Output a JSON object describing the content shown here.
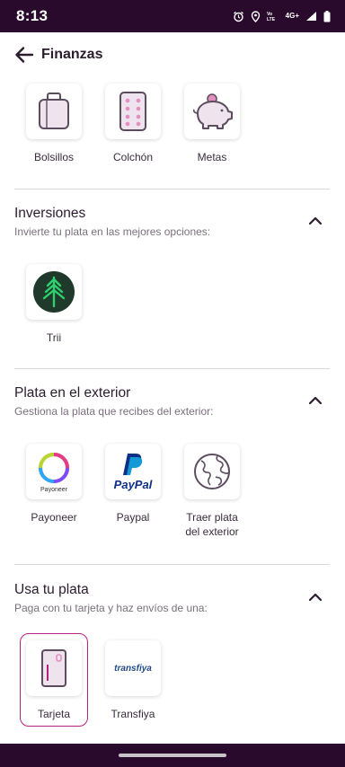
{
  "status_bar": {
    "time": "8:13",
    "network_label": "4G+",
    "icons": [
      "alarm-icon",
      "location-icon",
      "volte-icon",
      "signal-icon",
      "battery-icon"
    ]
  },
  "header": {
    "title": "Finanzas",
    "back_icon": "arrow-left-icon"
  },
  "top_tiles": [
    {
      "label": "Bolsillos",
      "icon": "wallet-icon"
    },
    {
      "label": "Colchón",
      "icon": "mattress-icon"
    },
    {
      "label": "Metas",
      "icon": "piggy-bank-icon"
    }
  ],
  "sections": [
    {
      "title": "Inversiones",
      "subtitle": "Invierte tu plata en las mejores opciones:",
      "expanded": true,
      "tiles": [
        {
          "label": "Trii",
          "icon": "trii-logo"
        }
      ]
    },
    {
      "title": "Plata en el exterior",
      "subtitle": "Gestiona la plata que recibes del exterior:",
      "expanded": true,
      "tiles": [
        {
          "label": "Payoneer",
          "icon": "payoneer-logo",
          "logo_text": "Payoneer"
        },
        {
          "label": "Paypal",
          "icon": "paypal-logo",
          "logo_text": "PayPal"
        },
        {
          "label": "Traer plata del exterior",
          "icon": "globe-icon"
        }
      ]
    },
    {
      "title": "Usa tu plata",
      "subtitle": "Paga con tu tarjeta y haz envíos de una:",
      "expanded": true,
      "tiles": [
        {
          "label": "Tarjeta",
          "icon": "card-icon",
          "selected": true
        },
        {
          "label": "Transfiya",
          "icon": "transfiya-logo",
          "logo_text": "transfiya"
        }
      ]
    }
  ],
  "colors": {
    "status_bar": "#2a0a2c",
    "accent": "#b3237d",
    "icon_stroke": "#5b4d5e",
    "icon_pink": "#e28fbf",
    "trii_green": "#1f3a2a"
  }
}
